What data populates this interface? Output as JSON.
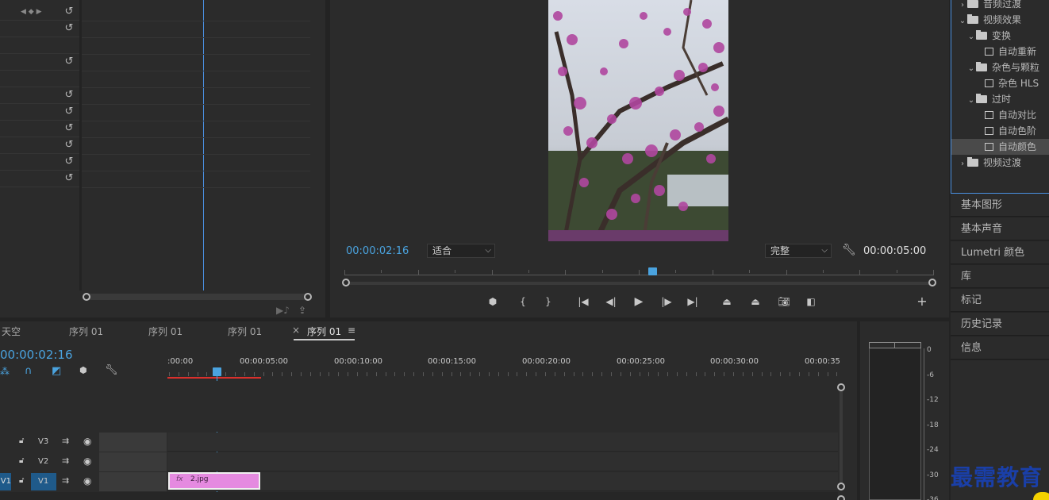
{
  "program_monitor": {
    "current_timecode": "00:00:02:16",
    "zoom_select": "适合",
    "quality_select": "完整",
    "duration_timecode": "00:00:05:00"
  },
  "effects_tree": [
    {
      "label": "音频过渡",
      "type": "folder",
      "level": 0,
      "expanded": false
    },
    {
      "label": "视频效果",
      "type": "folder",
      "level": 0,
      "expanded": true
    },
    {
      "label": "变换",
      "type": "folder",
      "level": 1,
      "expanded": true
    },
    {
      "label": "自动重新",
      "type": "effect",
      "level": 2
    },
    {
      "label": "杂色与颗粒",
      "type": "folder",
      "level": 1,
      "expanded": true
    },
    {
      "label": "杂色 HLS",
      "type": "effect",
      "level": 2
    },
    {
      "label": "过时",
      "type": "folder",
      "level": 1,
      "expanded": true
    },
    {
      "label": "自动对比",
      "type": "effect",
      "level": 2
    },
    {
      "label": "自动色阶",
      "type": "effect",
      "level": 2
    },
    {
      "label": "自动颜色",
      "type": "effect",
      "level": 2,
      "selected": true
    },
    {
      "label": "视频过渡",
      "type": "folder",
      "level": 0,
      "expanded": false
    }
  ],
  "side_panels": [
    "基本图形",
    "基本声音",
    "Lumetri 颜色",
    "库",
    "标记",
    "历史记录",
    "信息"
  ],
  "timeline": {
    "tabs": [
      {
        "label": "天空",
        "active": false
      },
      {
        "label": "序列 01",
        "active": false
      },
      {
        "label": "序列 01",
        "active": false
      },
      {
        "label": "序列 01",
        "active": false
      },
      {
        "label": "序列 01",
        "active": true
      }
    ],
    "close_glyph": "×",
    "menu_glyph": "≡",
    "timecode": "00:00:02:16",
    "ruler_labels": [
      ":00:00",
      "00:00:05:00",
      "00:00:10:00",
      "00:00:15:00",
      "00:00:20:00",
      "00:00:25:00",
      "00:00:30:00",
      "00:00:35"
    ],
    "tracks": [
      {
        "name": "V3"
      },
      {
        "name": "V2"
      },
      {
        "name": "V1",
        "source": "V1"
      }
    ],
    "clip": {
      "fx": "fx",
      "name": "2.jpg"
    }
  },
  "meter": {
    "db_labels": [
      "0",
      "-6",
      "-12",
      "-18",
      "-24",
      "-30",
      "-36"
    ]
  },
  "watermark": "最需教育",
  "colors": {
    "accent": "#4a90e2",
    "clip": "#e58ae0",
    "panel": "#2b2b2b",
    "background": "#232323"
  }
}
